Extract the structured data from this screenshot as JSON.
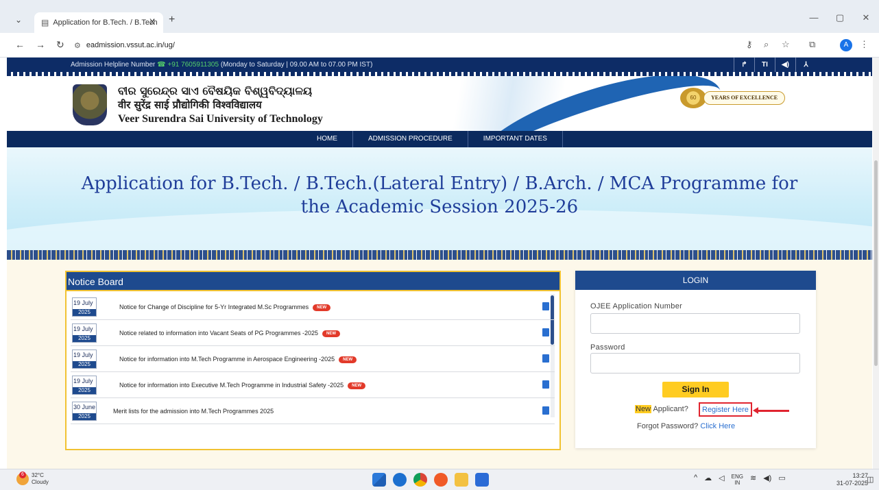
{
  "browser": {
    "tab_title": "Application for B.Tech. / B.Tech",
    "tab_close": "X",
    "new_tab": "+",
    "url": "eadmission.vssut.ac.in/ug/",
    "profile_initial": "A",
    "window_controls": [
      "—",
      "▢",
      "✕"
    ]
  },
  "site": {
    "helpline_label": "Admission Helpline Number",
    "helpline_phone": "+91 7605911305",
    "helpline_hours": "(Monday to Saturday | 09.00 AM to 07.00 PM IST)",
    "access_tools": [
      "↱",
      "TI",
      "◀)",
      "⅄"
    ],
    "univ_odia": "ବୀର ସୁରେନ୍ଦ୍ର ସାଏ ବୈଷୟିକ ବିଶ୍ୱବିଦ୍ୟାଳୟ",
    "univ_hindi": "वीर सुरेंद्र साई प्रौद्योगिकी विश्वविद्यालय",
    "univ_english": "Veer Surendra Sai University of Technology",
    "badge_seal": "60",
    "badge_text": "YEARS OF EXCELLENCE",
    "nav": [
      "HOME",
      "ADMISSION PROCEDURE",
      "IMPORTANT DATES"
    ],
    "banner_title_line1": "Application for B.Tech. / B.Tech.(Lateral Entry) / B.Arch. / MCA Programme for",
    "banner_title_line2": "the Academic Session 2025-26"
  },
  "notice_board": {
    "heading": "Notice Board",
    "new_label": "NEW",
    "items": [
      {
        "date": "19 July",
        "year": "2025",
        "title": "Notice for Change of Discipline for 5-Yr Integrated M.Sc Programmes",
        "is_new": true
      },
      {
        "date": "19 July",
        "year": "2025",
        "title": "Notice related to information into Vacant Seats of PG Programmes -2025",
        "is_new": true
      },
      {
        "date": "19 July",
        "year": "2025",
        "title": "Notice for information into M.Tech Programme in Aerospace Engineering -2025",
        "is_new": true
      },
      {
        "date": "19 July",
        "year": "2025",
        "title": "Notice for information into Executive M.Tech Programme in Industrial Safety -2025",
        "is_new": true
      },
      {
        "date": "30 June",
        "year": "2025",
        "title": "Merit lists for the admission into M.Tech Programmes 2025",
        "is_new": false
      }
    ]
  },
  "login": {
    "heading": "LOGIN",
    "app_number_label": "OJEE Application Number",
    "password_label": "Password",
    "sign_in": "Sign In",
    "new_highlight": "New",
    "applicant_text": "Applicant?",
    "register_link": "Register Here",
    "forgot_text": "Forgot Password?",
    "forgot_link": "Click Here"
  },
  "taskbar": {
    "weather_temp": "32°C",
    "weather_desc": "Cloudy",
    "weather_badge": "6",
    "lang_line1": "ENG",
    "lang_line2": "IN",
    "time": "13:27",
    "date": "31-07-2025"
  },
  "colors": {
    "navy": "#0b2a5e",
    "board_blue": "#1e4a8e",
    "gold": "#f1c232",
    "sign_in_yellow": "#ffcc22",
    "register_red": "#e0242f",
    "banner_title": "#1f3d99"
  }
}
